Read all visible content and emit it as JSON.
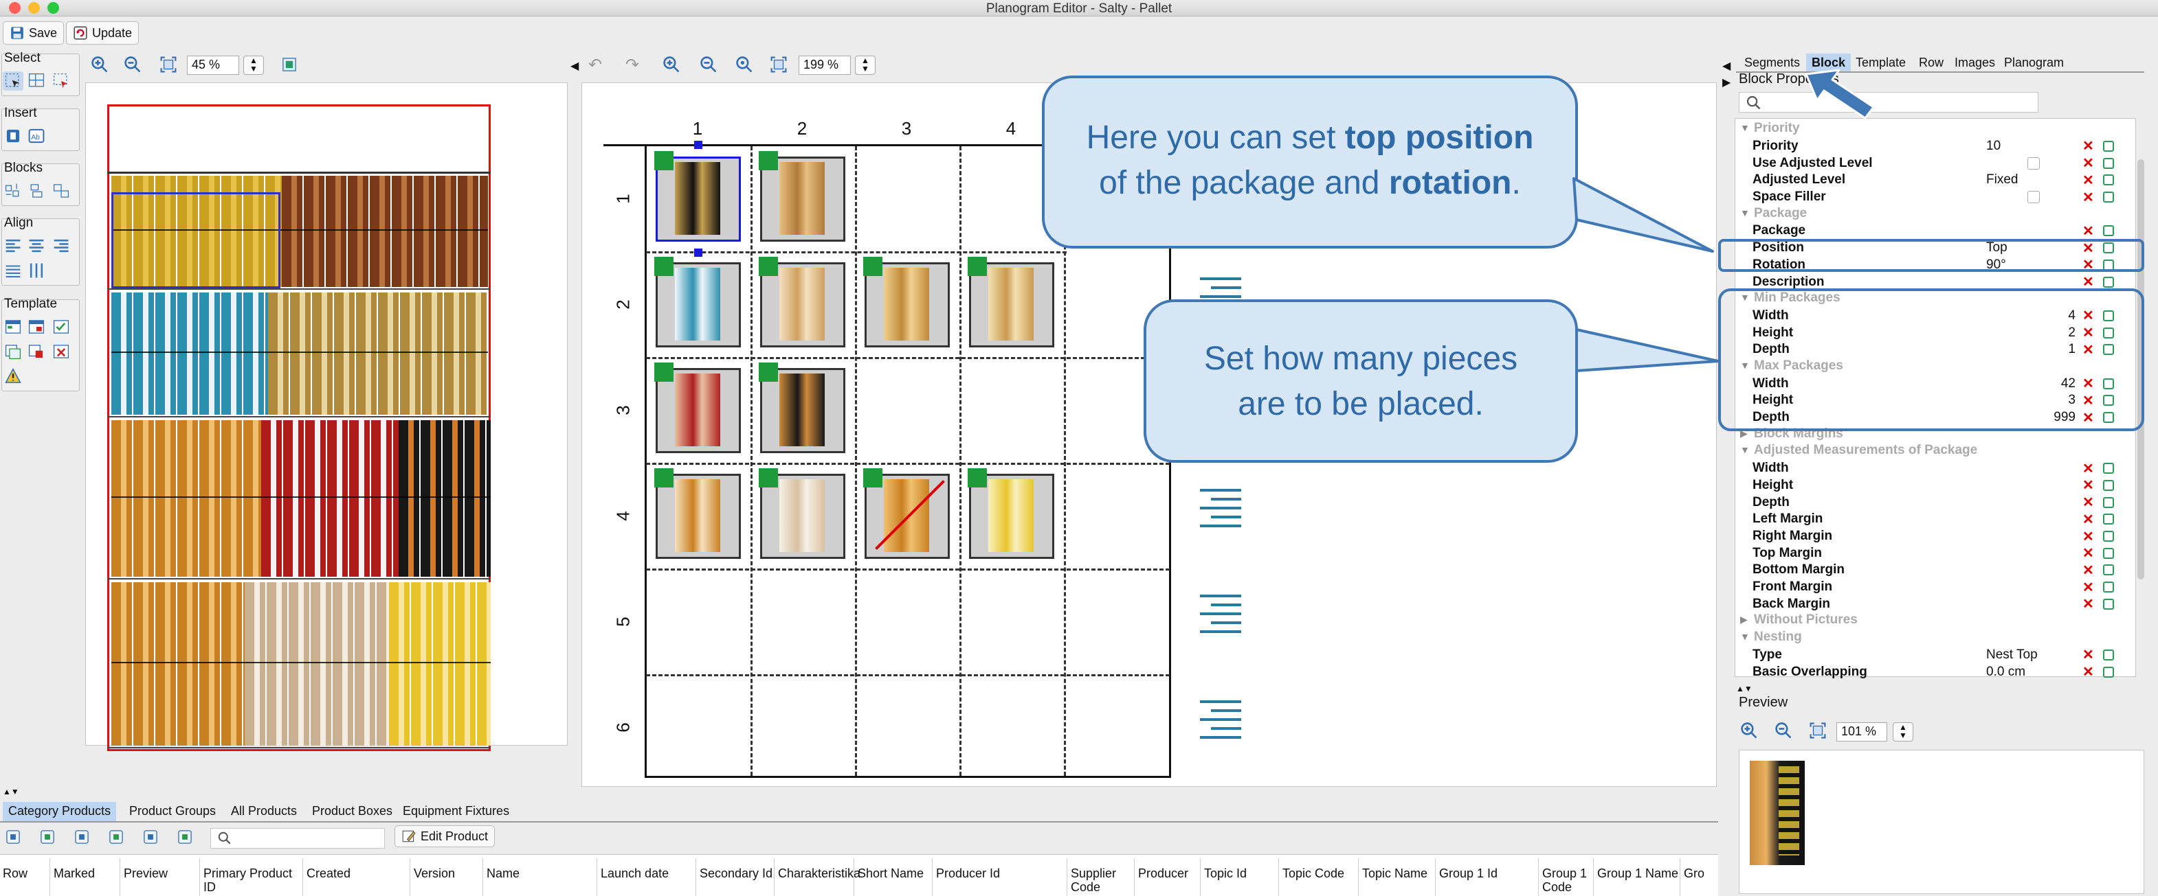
{
  "window": {
    "title": "Planogram Editor - Salty - Pallet"
  },
  "toolbar": {
    "save": "Save",
    "update": "Update"
  },
  "left_tools": {
    "select": "Select",
    "insert": "Insert",
    "blocks": "Blocks",
    "align": "Align",
    "template": "Template"
  },
  "left_view": {
    "zoom": "45 %"
  },
  "grid_view": {
    "zoom": "199 %",
    "columns": [
      "1",
      "2",
      "3",
      "4"
    ],
    "rows": [
      "1",
      "2",
      "3",
      "4",
      "5",
      "6"
    ]
  },
  "right_tabs": [
    "Segments",
    "Block",
    "Template",
    "Row",
    "Images",
    "Planogram"
  ],
  "active_tab": "Block",
  "block_properties": {
    "title": "Block Properties",
    "search_placeholder": "",
    "sections": {
      "priority": "Priority",
      "package": "Package",
      "min_packages": "Min Packages",
      "max_packages": "Max Packages",
      "block_margins": "Block Margins",
      "adjusted": "Adjusted Measurements of Package",
      "without_pictures": "Without Pictures",
      "nesting": "Nesting"
    },
    "priority": {
      "priority_label": "Priority",
      "priority_value": "10",
      "use_adjusted_level": "Use Adjusted Level",
      "adjusted_level": "Adjusted Level",
      "adjusted_level_value": "Fixed",
      "space_filler": "Space Filler"
    },
    "package": {
      "package_label": "Package",
      "position_label": "Position",
      "position_value": "Top",
      "rotation_label": "Rotation",
      "rotation_value": "90°",
      "description_label": "Description"
    },
    "min": {
      "width_label": "Width",
      "width": "4",
      "height_label": "Height",
      "height": "2",
      "depth_label": "Depth",
      "depth": "1"
    },
    "max": {
      "width_label": "Width",
      "width": "42",
      "height_label": "Height",
      "height": "3",
      "depth_label": "Depth",
      "depth": "999"
    },
    "adjusted": {
      "width": "Width",
      "height": "Height",
      "depth": "Depth",
      "left": "Left Margin",
      "right": "Right Margin",
      "top": "Top Margin",
      "bottom": "Bottom Margin",
      "front": "Front Margin",
      "back": "Back Margin"
    },
    "nesting": {
      "type_label": "Type",
      "type_value": "Nest Top",
      "overlap_label": "Basic Overlapping",
      "overlap_value": "0.0 cm"
    }
  },
  "preview": {
    "title": "Preview",
    "zoom": "101 %"
  },
  "callouts": {
    "top_pre": "Here you can set ",
    "top_b1": "top position",
    "top_mid": "of the package and ",
    "top_b2": "rotation",
    "top_end": ".",
    "pieces_line1": "Set how many pieces",
    "pieces_line2": "are to be placed."
  },
  "bottom_tabs": [
    "Category Products",
    "Product Groups",
    "All Products",
    "Product Boxes",
    "Equipment Fixtures"
  ],
  "bottom_toolbar": {
    "edit_product": "Edit Product",
    "search_placeholder": ""
  },
  "table_columns": [
    "Row",
    "Marked",
    "Preview",
    "Primary Product ID",
    "Created",
    "Version",
    "Name",
    "Launch date",
    "Secondary Id",
    "Charakteristika",
    "Short Name",
    "Producer Id",
    "Supplier Code",
    "Producer",
    "Topic Id",
    "Topic Code",
    "Topic Name",
    "Group 1 Id",
    "Group 1 Code",
    "Group 1 Name",
    "Gro"
  ],
  "colors": {
    "accent": "#3f78b5",
    "callout_fill": "#d6e6f5",
    "marker": "#1e9a3a",
    "selection": "#1a1adb",
    "frame": "#e01010"
  }
}
